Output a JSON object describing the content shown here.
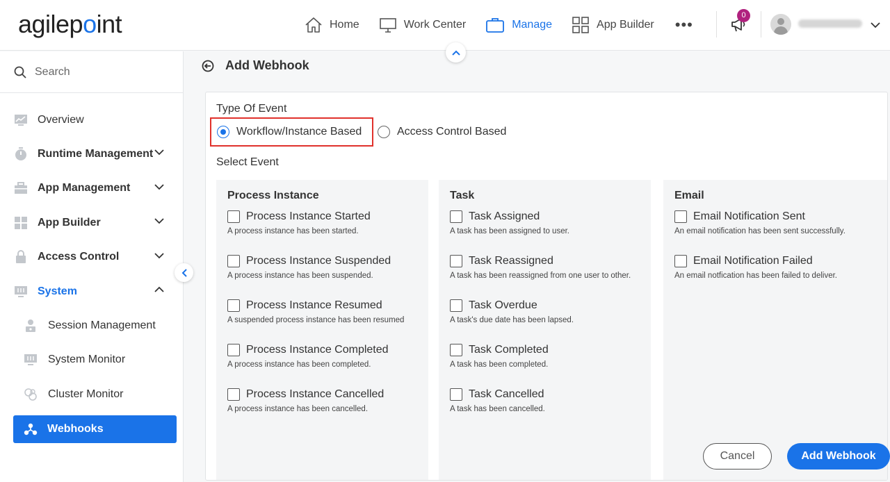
{
  "brand": {
    "logo_prefix": "agilep",
    "logo_dot": "o",
    "logo_suffix": "int"
  },
  "nav": {
    "items": [
      {
        "label": "Home",
        "icon": "home-icon"
      },
      {
        "label": "Work Center",
        "icon": "monitor-icon"
      },
      {
        "label": "Manage",
        "icon": "briefcase-icon",
        "active": true
      },
      {
        "label": "App Builder",
        "icon": "grid-icon"
      }
    ],
    "more": "•••",
    "notifications_count": "0"
  },
  "sidebar": {
    "search_placeholder": "Search",
    "items": [
      {
        "label": "Overview",
        "icon": "chart-icon"
      },
      {
        "label": "Runtime Management",
        "icon": "timer-icon",
        "expandable": true
      },
      {
        "label": "App Management",
        "icon": "toolbox-icon",
        "expandable": true
      },
      {
        "label": "App Builder",
        "icon": "blocks-icon",
        "expandable": true
      },
      {
        "label": "Access Control",
        "icon": "lock-icon",
        "expandable": true
      },
      {
        "label": "System",
        "icon": "system-icon",
        "expandable": true,
        "open": true
      }
    ],
    "sub_items": [
      {
        "label": "Session Management",
        "icon": "user-lock-icon"
      },
      {
        "label": "System Monitor",
        "icon": "monitor-settings-icon"
      },
      {
        "label": "Cluster Monitor",
        "icon": "cluster-icon"
      },
      {
        "label": "Webhooks",
        "icon": "webhook-icon",
        "selected": true
      }
    ]
  },
  "page": {
    "title": "Add Webhook",
    "type_of_event_label": "Type Of Event",
    "radio_options": [
      {
        "label": "Workflow/Instance Based",
        "checked": true
      },
      {
        "label": "Access Control Based",
        "checked": false
      }
    ],
    "select_event_label": "Select Event",
    "groups": [
      {
        "title": "Process Instance",
        "events": [
          {
            "label": "Process Instance Started",
            "desc": "A process instance has been started."
          },
          {
            "label": "Process Instance Suspended",
            "desc": "A process instance has been suspended."
          },
          {
            "label": "Process Instance Resumed",
            "desc": "A suspended process instance has been resumed"
          },
          {
            "label": "Process Instance Completed",
            "desc": "A process instance has been completed."
          },
          {
            "label": "Process Instance Cancelled",
            "desc": "A process instance has been cancelled."
          }
        ]
      },
      {
        "title": "Task",
        "events": [
          {
            "label": "Task Assigned",
            "desc": "A task has been assigned to user."
          },
          {
            "label": "Task Reassigned",
            "desc": "A task has been reassigned from one user to other."
          },
          {
            "label": "Task Overdue",
            "desc": "A task's due date has been lapsed."
          },
          {
            "label": "Task Completed",
            "desc": "A task has been completed."
          },
          {
            "label": "Task Cancelled",
            "desc": "A task has been cancelled."
          }
        ]
      },
      {
        "title": "Email",
        "events": [
          {
            "label": "Email Notification Sent",
            "desc": "An email notification has been sent successfully."
          },
          {
            "label": "Email Notification Failed",
            "desc": "An email notfication has been failed to deliver."
          }
        ]
      }
    ],
    "cancel_label": "Cancel",
    "submit_label": "Add Webhook"
  },
  "colors": {
    "accent": "#1a73e8",
    "highlight": "#e0312b",
    "badge": "#b0217e"
  }
}
